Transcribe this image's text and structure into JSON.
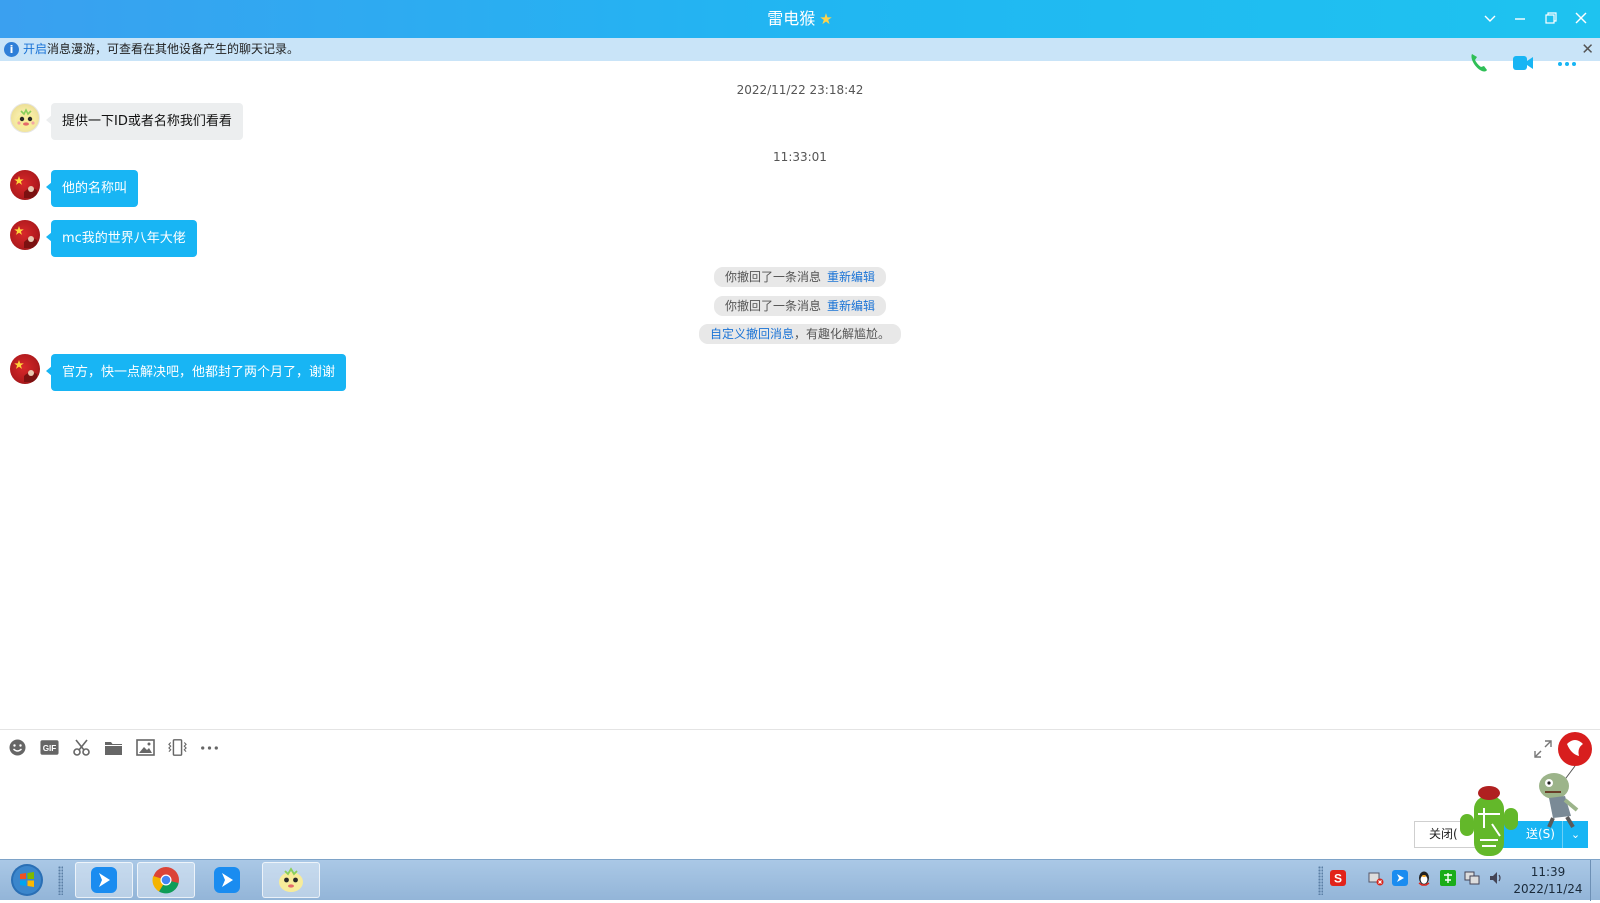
{
  "window": {
    "title": "雷电猴",
    "controls": [
      "chevron-down-icon",
      "minimize-icon",
      "restore-icon",
      "close-icon"
    ]
  },
  "infobar": {
    "link_text": "开启",
    "text": "消息漫游，可查看在其他设备产生的聊天记录。",
    "close_glyph": "✕"
  },
  "chat": {
    "timestamp_1": "2022/11/22 23:18:42",
    "timestamp_2": "11:33:01",
    "messages": [
      {
        "sender": "other",
        "text": "提供一下ID或者名称我们看看"
      },
      {
        "sender": "me",
        "text": "他的名称叫"
      },
      {
        "sender": "me",
        "text": "mc我的世界八年大佬"
      },
      {
        "sender": "me",
        "text": "官方，快一点解决吧，他都封了两个月了，谢谢"
      }
    ],
    "system": [
      {
        "text": "你撤回了一条消息",
        "link": "重新编辑"
      },
      {
        "text": "你撤回了一条消息",
        "link": "重新编辑"
      },
      {
        "link_first": "自定义撤回消息",
        "text": "，有趣化解尴尬。"
      }
    ]
  },
  "toolbar": {
    "tools": [
      "emoji-icon",
      "gif-icon",
      "scissors-icon",
      "folder-icon",
      "image-icon",
      "vibrate-icon",
      "more-icon"
    ],
    "gif_label": "GIF"
  },
  "buttons": {
    "close_label": "关闭(",
    "send_label": "送(S)",
    "send_arrow": "⌄"
  },
  "taskbar": {
    "clock_time": "11:39",
    "clock_date": "2022/11/24",
    "tray_sogou_label": "S"
  },
  "colors": {
    "title_bar": "#21b6f2",
    "bubble_me": "#18b5f4",
    "bubble_other": "#eceeef",
    "link": "#1a73d6",
    "infobar": "#c9e4f8"
  }
}
